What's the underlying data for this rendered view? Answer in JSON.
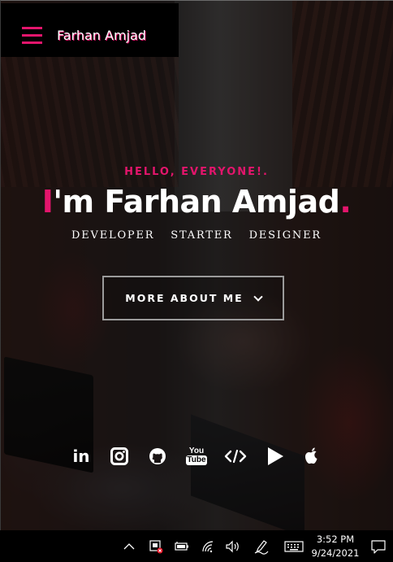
{
  "navbar": {
    "brand": "Farhan Amjad",
    "accent_color": "#e3156c",
    "menu_icon": "hamburger-menu-icon"
  },
  "hero": {
    "greeting": "HELLO, EVERYONE!.",
    "name_tick": "I",
    "name_rest": "'m Farhan Amjad",
    "name_dot": ".",
    "roles": [
      "DEVELOPER",
      "STARTER",
      "DESIGNER"
    ],
    "cta_label": "MORE ABOUT ME",
    "cta_icon": "chevron-down-icon"
  },
  "social": {
    "linkedin_label": "in",
    "items": [
      "linkedin-icon",
      "instagram-icon",
      "github-icon",
      "youtube-icon",
      "code-icon",
      "play-icon",
      "apple-icon"
    ],
    "youtube_top": "You",
    "youtube_bottom": "Tube"
  },
  "taskbar": {
    "time": "3:52 PM",
    "date": "9/24/2021",
    "icons": [
      "chevron-up-icon",
      "security-icon",
      "battery-icon",
      "wifi-icon",
      "volume-icon",
      "pen-icon",
      "keyboard-icon",
      "notification-icon"
    ]
  }
}
